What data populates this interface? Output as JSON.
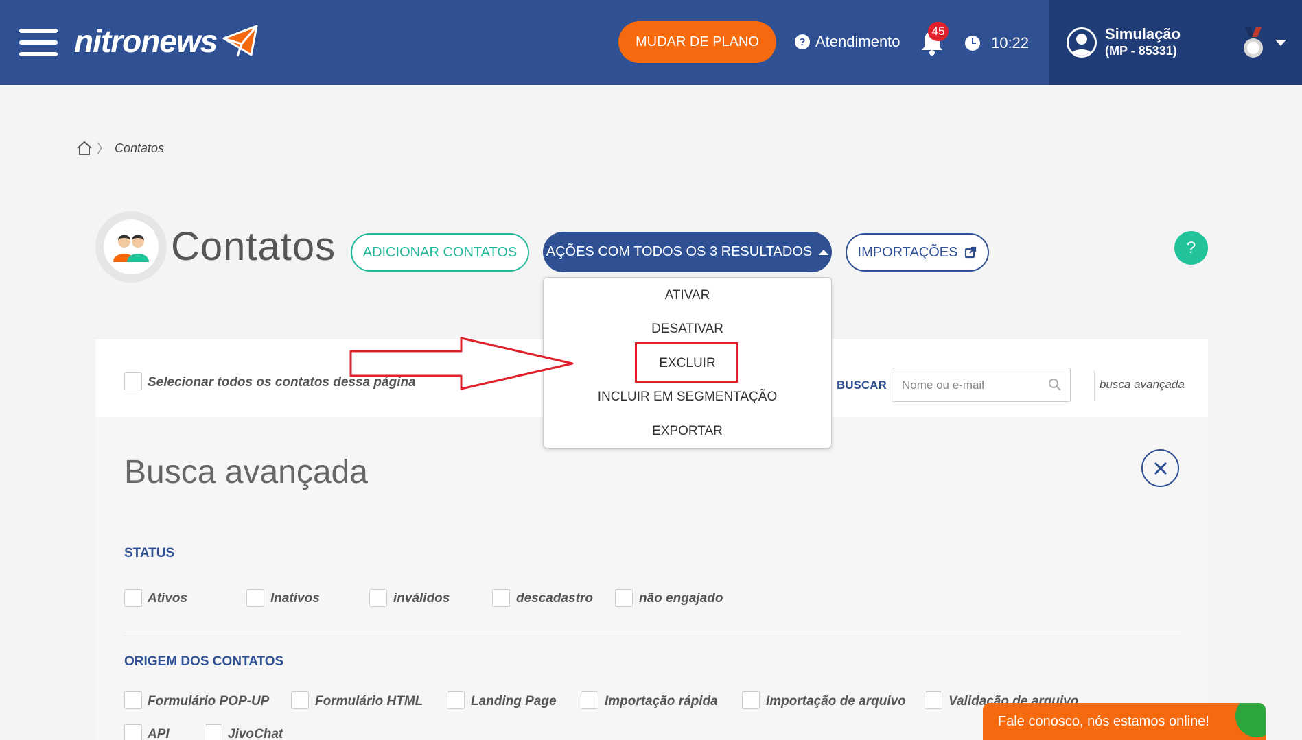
{
  "header": {
    "logo_text": "nitronews",
    "plan_button": "MUDAR DE PLANO",
    "help_label": "Atendimento",
    "notifications_count": "45",
    "time": "10:22",
    "user_name": "Simulação",
    "user_id": "(MP - 85331)",
    "colors": {
      "primary": "#2f5194",
      "dark": "#213d77",
      "accent": "#f5690f"
    }
  },
  "breadcrumb": {
    "current": "Contatos",
    "separator": "〉"
  },
  "page": {
    "title": "Contatos",
    "add_button": "ADICIONAR CONTATOS",
    "actions_button": "AÇÕES COM TODOS OS 3 RESULTADOS",
    "imports_button": "IMPORTAÇÕES",
    "help_button": "?"
  },
  "dropdown": {
    "items": [
      "ATIVAR",
      "DESATIVAR",
      "EXCLUIR",
      "INCLUIR EM SEGMENTAÇÃO",
      "EXPORTAR"
    ],
    "highlighted": "EXCLUIR"
  },
  "toolbar": {
    "select_all_label": "Selecionar todos os contatos dessa página",
    "search_label": "BUSCAR",
    "search_placeholder": "Nome ou e-mail",
    "advanced_link": "busca avançada"
  },
  "advanced": {
    "title": "Busca avançada",
    "status_label": "STATUS",
    "status_options": [
      "Ativos",
      "Inativos",
      "inválidos",
      "descadastro",
      "não engajado"
    ],
    "origin_label": "ORIGEM DOS CONTATOS",
    "origin_options": [
      "Formulário POP-UP",
      "Formulário HTML",
      "Landing Page",
      "Importação rápida",
      "Importação de arquivo",
      "Validação de arquivo",
      "API",
      "JivoChat"
    ]
  },
  "chat": {
    "label": "Fale conosco, nós estamos online!"
  }
}
